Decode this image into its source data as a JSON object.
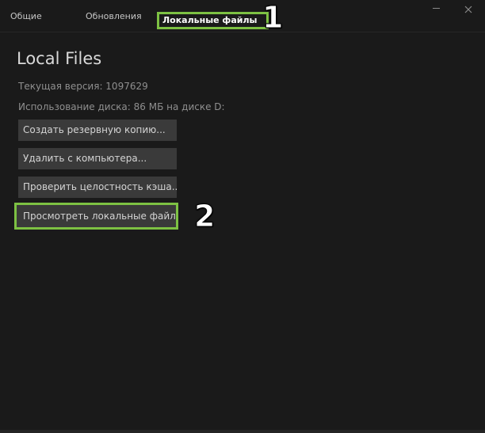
{
  "tabs": {
    "general": "Общие",
    "updates": "Обновления",
    "local_files": "Локальные файлы"
  },
  "annotations": {
    "one": "1",
    "two": "2"
  },
  "content": {
    "title": "Local Files",
    "version": "Текущая версия: 1097629",
    "disk_usage": "Использование диска: 86 МБ на диске D:"
  },
  "buttons": {
    "backup": "Создать резервную копию...",
    "delete": "Удалить с компьютера...",
    "verify": "Проверить целостность кэша...",
    "browse": "Просмотреть локальные файлы..."
  },
  "colors": {
    "highlight": "#7dc143",
    "background": "#1a1a1a",
    "button": "#3a3a3a"
  },
  "icons": {
    "minimize": "minimize-icon",
    "close": "close-icon"
  }
}
